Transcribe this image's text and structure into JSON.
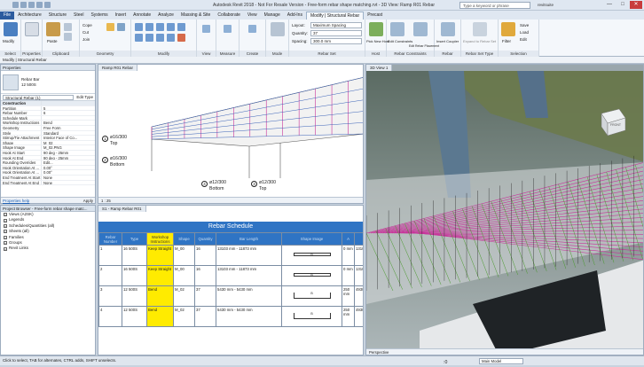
{
  "window": {
    "title": "Autodesk Revit 2018 - Not For Resale Version - Free-form rebar shape matching.rvt - 3D View: Ramp R01 Rebar",
    "search_placeholder": "Type a keyword or phrase",
    "user": "revitsuite",
    "minimize": "—",
    "maximize": "□",
    "close": "✕"
  },
  "tabs": [
    "File",
    "Architecture",
    "Structure",
    "Steel",
    "Systems",
    "Insert",
    "Annotate",
    "Analyze",
    "Massing & Site",
    "Collaborate",
    "View",
    "Manage",
    "Add-Ins",
    "Modify | Structural Rebar",
    "Precast"
  ],
  "ribbon": {
    "modify": "Modify",
    "paste": "Paste",
    "cope": "Cope",
    "cut": "Cut",
    "join": "Join",
    "groups": [
      "Select",
      "Properties",
      "Clipboard",
      "Geometry",
      "Modify",
      "View",
      "Measure",
      "Create",
      "Mode",
      "Rebar Set",
      "Host",
      "Rebar Constraints",
      "Rebar Coupler",
      "Rebar Set Type",
      "Selection"
    ],
    "layout_label": "Layout:",
    "layout_value": "Maximum Spacing",
    "quantity_label": "Quantity:",
    "quantity_value": "37",
    "spacing_label": "Spacing:",
    "spacing_value": "300.0 mm",
    "pick_new_host": "Pick New Host",
    "edit_constraints": "Edit Constraints",
    "edit_rebar_placement": "Edit Rebar Placement",
    "insert_coupler": "Insert Coupler",
    "expand_to_rebar_set": "Expand to Rebar Set",
    "filter": "Filter",
    "save": "Save",
    "load": "Load",
    "edit": "Edit"
  },
  "options_bar": "Modify | Structural Rebar",
  "properties": {
    "header": "Properties",
    "type_name": "Rebar Bar",
    "type_size": "12 500S",
    "selector": "Structural Rebar (1)",
    "edit_type": "Edit Type",
    "rows": [
      {
        "k": "Construction",
        "v": "",
        "cat": true
      },
      {
        "k": "Partition",
        "v": "5"
      },
      {
        "k": "Rebar Number",
        "v": "6"
      },
      {
        "k": "Schedule Mark",
        "v": ""
      },
      {
        "k": "Workshop Instructions",
        "v": "Bend"
      },
      {
        "k": "Geometry",
        "v": "Free Form"
      },
      {
        "k": "Style",
        "v": "Standard"
      },
      {
        "k": "Stirrup/Tie Attachment",
        "v": "Interior Face of Co..."
      },
      {
        "k": "Shape",
        "v": "M_02"
      },
      {
        "k": "Shape Image",
        "v": "M_02.PNG"
      },
      {
        "k": "Hook At Start",
        "v": "90 deg - 25mm"
      },
      {
        "k": "Hook At End",
        "v": "90 deg - 25mm"
      },
      {
        "k": "Rounding Overrides",
        "v": "Edit..."
      },
      {
        "k": "Hook Orientation At ...",
        "v": "0.00°"
      },
      {
        "k": "Hook Orientation At ...",
        "v": "0.00°"
      },
      {
        "k": "End Treatment At Start",
        "v": "None"
      },
      {
        "k": "End Treatment At End",
        "v": "None"
      }
    ],
    "help": "Properties help",
    "apply": "Apply"
  },
  "browser": {
    "header": "Project Browser - Free-form rebar shape matc...",
    "items": [
      "Views (A2SK)",
      "Legends",
      "Schedules/Quantities (all)",
      "Sheets (all)",
      "Families",
      "Groups",
      "Revit Links"
    ]
  },
  "view1": {
    "tab": "Ramp R01 Rebar",
    "annotations": [
      {
        "n": "1",
        "t": "ø16/300",
        "s": "Top"
      },
      {
        "n": "2",
        "t": "ø16/300",
        "s": "Bottom"
      },
      {
        "n": "4",
        "t": "ø12/300",
        "s": "Bottom"
      },
      {
        "n": "3",
        "t": "ø12/300",
        "s": "Top"
      }
    ],
    "scale": "1 : 25"
  },
  "view2": {
    "tab": "S1 - Ramp Rebar R01",
    "title": "Rebar Schedule",
    "columns": [
      "Rebar Number",
      "Type",
      "Workshop Instructions",
      "Shape",
      "Quantity",
      "Bar Length",
      "Shape Image",
      "A"
    ],
    "rows": [
      {
        "num": "1",
        "type": "16 500S",
        "wi": "Keep Straight",
        "shape": "M_00",
        "qty": "16",
        "len": "13103 mm - 11873 mm",
        "a": "0 mm",
        "b": "13103"
      },
      {
        "num": "2",
        "type": "16 500S",
        "wi": "Keep Straight",
        "shape": "M_00",
        "qty": "16",
        "len": "13103 mm - 11873 mm",
        "a": "0 mm",
        "b": "13103"
      },
      {
        "num": "3",
        "type": "12 500S",
        "wi": "Bend",
        "shape": "M_02",
        "qty": "37",
        "len": "5430 mm - 5430 mm",
        "a": "250 mm",
        "b": "4930"
      },
      {
        "num": "4",
        "type": "12 500S",
        "wi": "Bend",
        "shape": "M_02",
        "qty": "37",
        "len": "5430 mm - 5430 mm",
        "a": "250 mm",
        "b": "4930"
      }
    ],
    "shape_b": "B"
  },
  "view3": {
    "tab": "3D View 1",
    "viewcube": "FRONT",
    "mode": "Perspective"
  },
  "status": {
    "text": "Click to select, TAB for alternates, CTRL adds, SHIFT unselects.",
    "model": "Main Model",
    "zero": ":0"
  },
  "colors": {
    "accent": "#2f74c4",
    "highlight": "#ffeb00",
    "rebar_magenta": "#c8329a",
    "rebar_green": "#4a9a2e"
  }
}
